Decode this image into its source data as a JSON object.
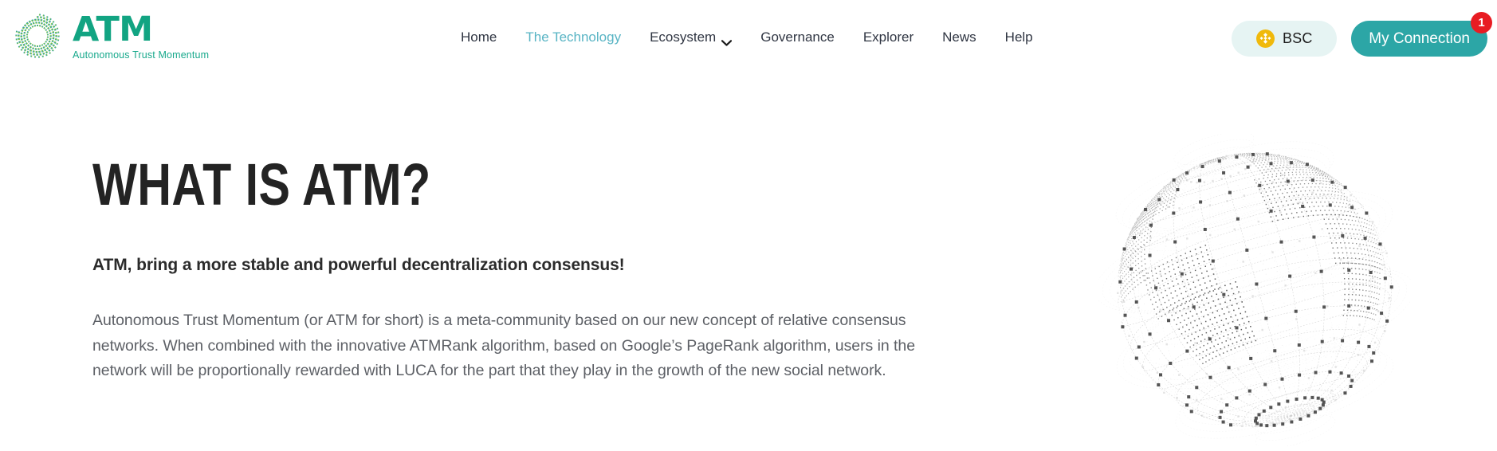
{
  "brand": {
    "title": "ATM",
    "tagline": "Autonomous Trust Momentum",
    "logo_icon": "dotted-ring-logo-icon",
    "color_primary": "#12A482",
    "color_tagline": "#18A98C"
  },
  "nav": {
    "items": [
      {
        "label": "Home",
        "active": false,
        "has_dropdown": false
      },
      {
        "label": "The Technology",
        "active": true,
        "has_dropdown": false
      },
      {
        "label": "Ecosystem",
        "active": false,
        "has_dropdown": true
      },
      {
        "label": "Governance",
        "active": false,
        "has_dropdown": false
      },
      {
        "label": "Explorer",
        "active": false,
        "has_dropdown": false
      },
      {
        "label": "News",
        "active": false,
        "has_dropdown": false
      },
      {
        "label": "Help",
        "active": false,
        "has_dropdown": false
      }
    ],
    "active_color": "#58B4C4",
    "default_color": "#2f3542"
  },
  "actions": {
    "chain": {
      "label": "BSC",
      "icon": "binance-chain-icon",
      "icon_color": "#F0B90B",
      "background": "#E6F4F3"
    },
    "connection": {
      "label": "My Connection",
      "badge_count": "1",
      "background": "#2CA6A6",
      "badge_color": "#E81C23"
    }
  },
  "hero": {
    "title": "WHAT IS ATM?",
    "subtitle": "ATM, bring a more stable and powerful decentralization consensus!",
    "body": "Autonomous Trust Momentum (or ATM for short) is a meta-community based on our new concept of relative consensus networks. When combined with the innovative ATMRank algorithm, based on Google’s PageRank algorithm, users in the network will be proportionally rewarded with LUCA for the part that they play in the growth of the new social network.",
    "illustration": "wireframe-globe-icon"
  }
}
